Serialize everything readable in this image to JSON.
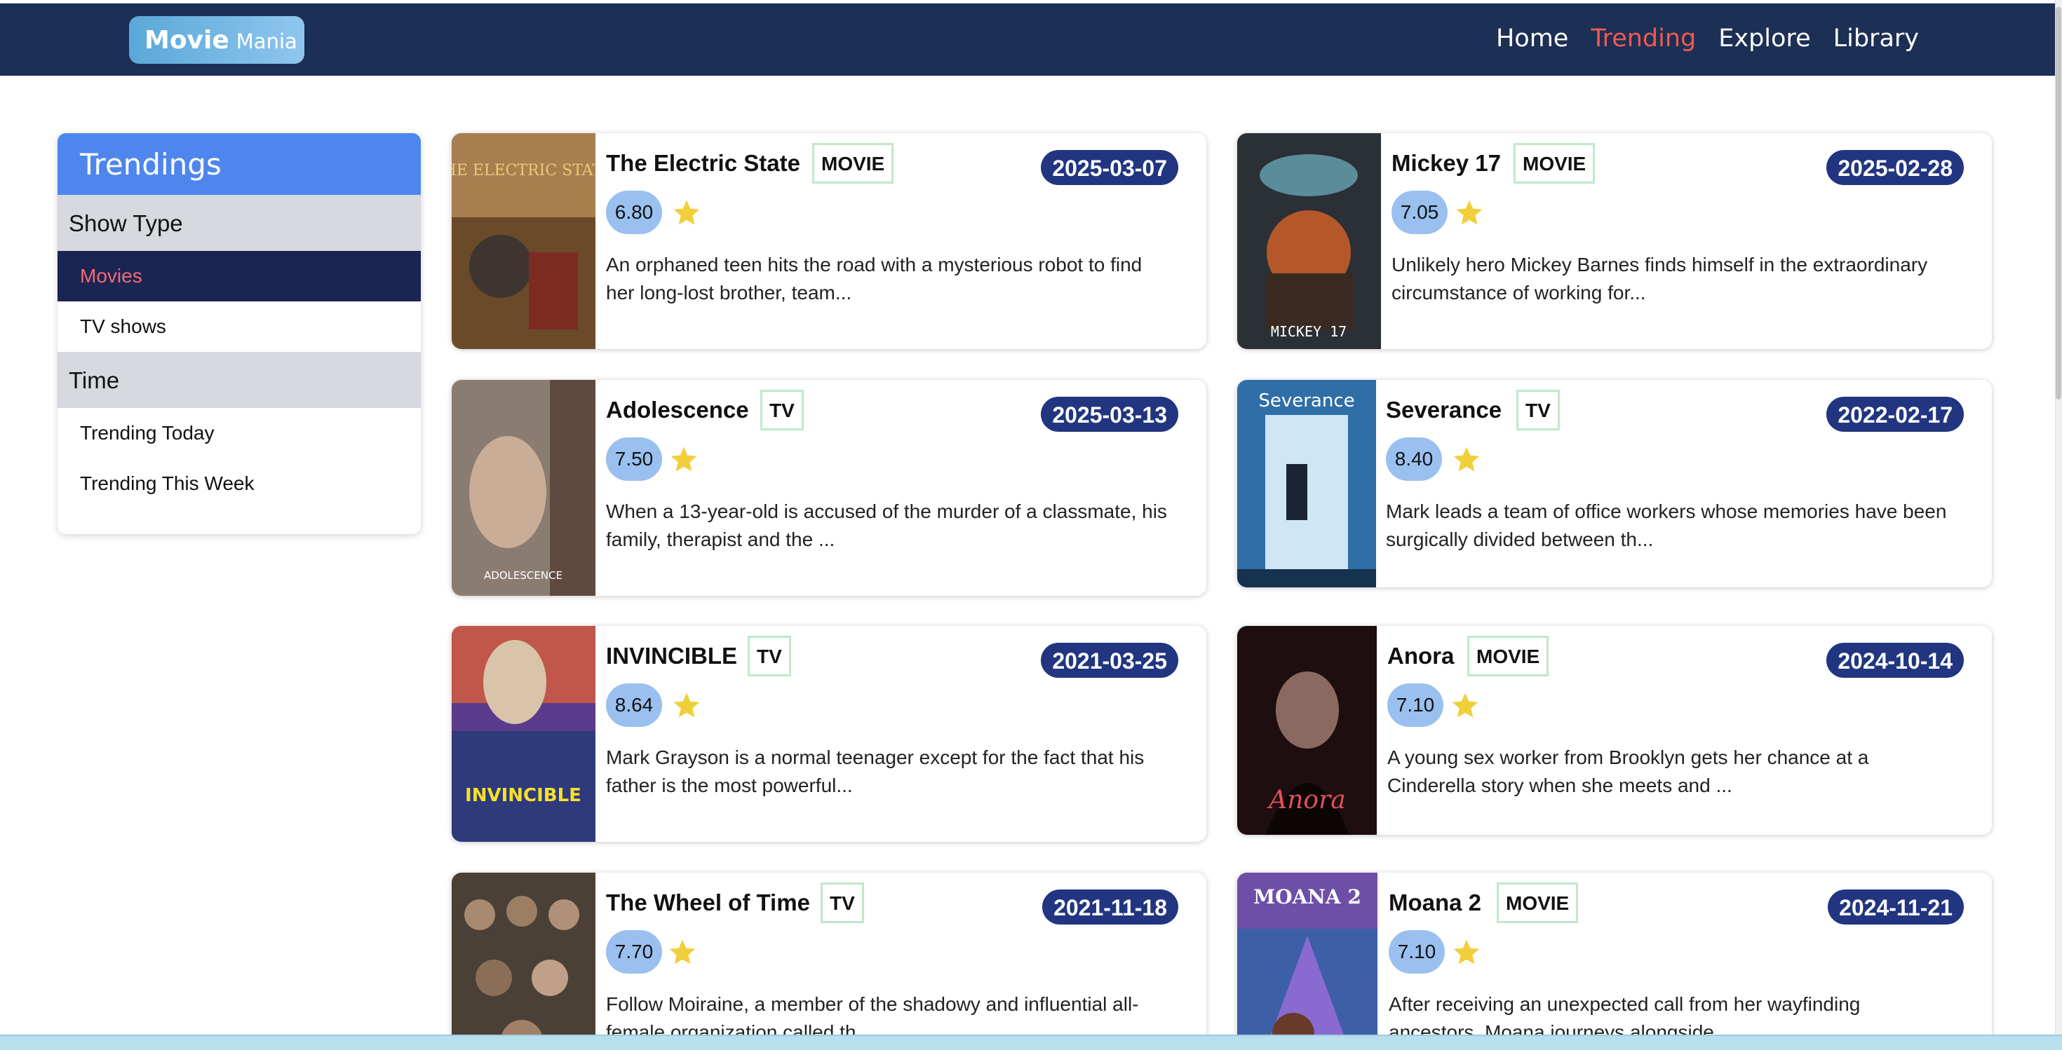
{
  "brand": {
    "title": "Movie",
    "subtitle": "Mania"
  },
  "nav": [
    {
      "label": "Home",
      "active": false
    },
    {
      "label": "Trending",
      "active": true
    },
    {
      "label": "Explore",
      "active": false
    },
    {
      "label": "Library",
      "active": false
    }
  ],
  "sidebar": {
    "title": "Trendings",
    "groups": [
      {
        "label": "Show Type",
        "items": [
          {
            "label": "Movies",
            "selected": true
          },
          {
            "label": "TV shows",
            "selected": false
          }
        ]
      },
      {
        "label": "Time",
        "items": [
          {
            "label": "Trending Today",
            "selected": false
          },
          {
            "label": "Trending This Week",
            "selected": false
          }
        ]
      }
    ]
  },
  "cards": [
    {
      "title": "The Electric State",
      "type": "MOVIE",
      "date": "2025-03-07",
      "rating": "6.80",
      "desc_line1": "An orphaned teen hits the road with a mysterious robot to find",
      "desc_line2": "her long-lost brother, team...",
      "poster_text": "THE ELECTRIC STATE",
      "poster_color": "#6b4a2a"
    },
    {
      "title": "Mickey 17",
      "type": "MOVIE",
      "date": "2025-02-28",
      "rating": "7.05",
      "desc_line1": "Unlikely hero Mickey Barnes finds himself in the extraordinary",
      "desc_line2": "circumstance of working for...",
      "poster_text": "MICKEY 17",
      "poster_color": "#3a3a3f"
    },
    {
      "title": "Adolescence",
      "type": "TV",
      "date": "2025-03-13",
      "rating": "7.50",
      "desc_line1": "When a 13-year-old is accused of the murder of a classmate, his",
      "desc_line2": "family, therapist and the ...",
      "poster_text": "ADOLESCENCE",
      "poster_color": "#7a6a5e"
    },
    {
      "title": "Severance",
      "type": "TV",
      "date": "2022-02-17",
      "rating": "8.40",
      "desc_line1": "Mark leads a team of office workers whose memories have been",
      "desc_line2": "surgically divided between th...",
      "poster_text": "Severance",
      "poster_color": "#2f6ea6"
    },
    {
      "title": "INVINCIBLE",
      "type": "TV",
      "date": "2021-03-25",
      "rating": "8.64",
      "desc_line1": "Mark Grayson is a normal teenager except for the fact that his",
      "desc_line2": "father is the most powerful...",
      "poster_text": "INVINCIBLE",
      "poster_color": "#5b3b8c"
    },
    {
      "title": "Anora",
      "type": "MOVIE",
      "date": "2024-10-14",
      "rating": "7.10",
      "desc_line1": "A young sex worker from Brooklyn gets her chance at a",
      "desc_line2": "Cinderella story when she meets and ...",
      "poster_text": "Anora",
      "poster_color": "#2a1416"
    },
    {
      "title": "The Wheel of Time",
      "type": "TV",
      "date": "2021-11-18",
      "rating": "7.70",
      "desc_line1": "Follow Moiraine, a member of the shadowy and influential all-",
      "desc_line2": "female organization called th...",
      "poster_text": "",
      "poster_color": "#4a4036"
    },
    {
      "title": "Moana 2",
      "type": "MOVIE",
      "date": "2024-11-21",
      "rating": "7.10",
      "desc_line1": "After receiving an unexpected call from her wayfinding",
      "desc_line2": "ancestors, Moana journeys alongside...",
      "poster_text": "MOANA 2",
      "poster_color": "#3d5fa8"
    }
  ],
  "colors": {
    "nav_bg": "#1c2f55",
    "active_nav": "#f05a4f",
    "sidebar_title_bg": "#4f86ee",
    "date_badge": "#213580",
    "rating_pill": "#99c0ef",
    "star": "#f1cf3b",
    "type_border": "#bfe9c9"
  }
}
